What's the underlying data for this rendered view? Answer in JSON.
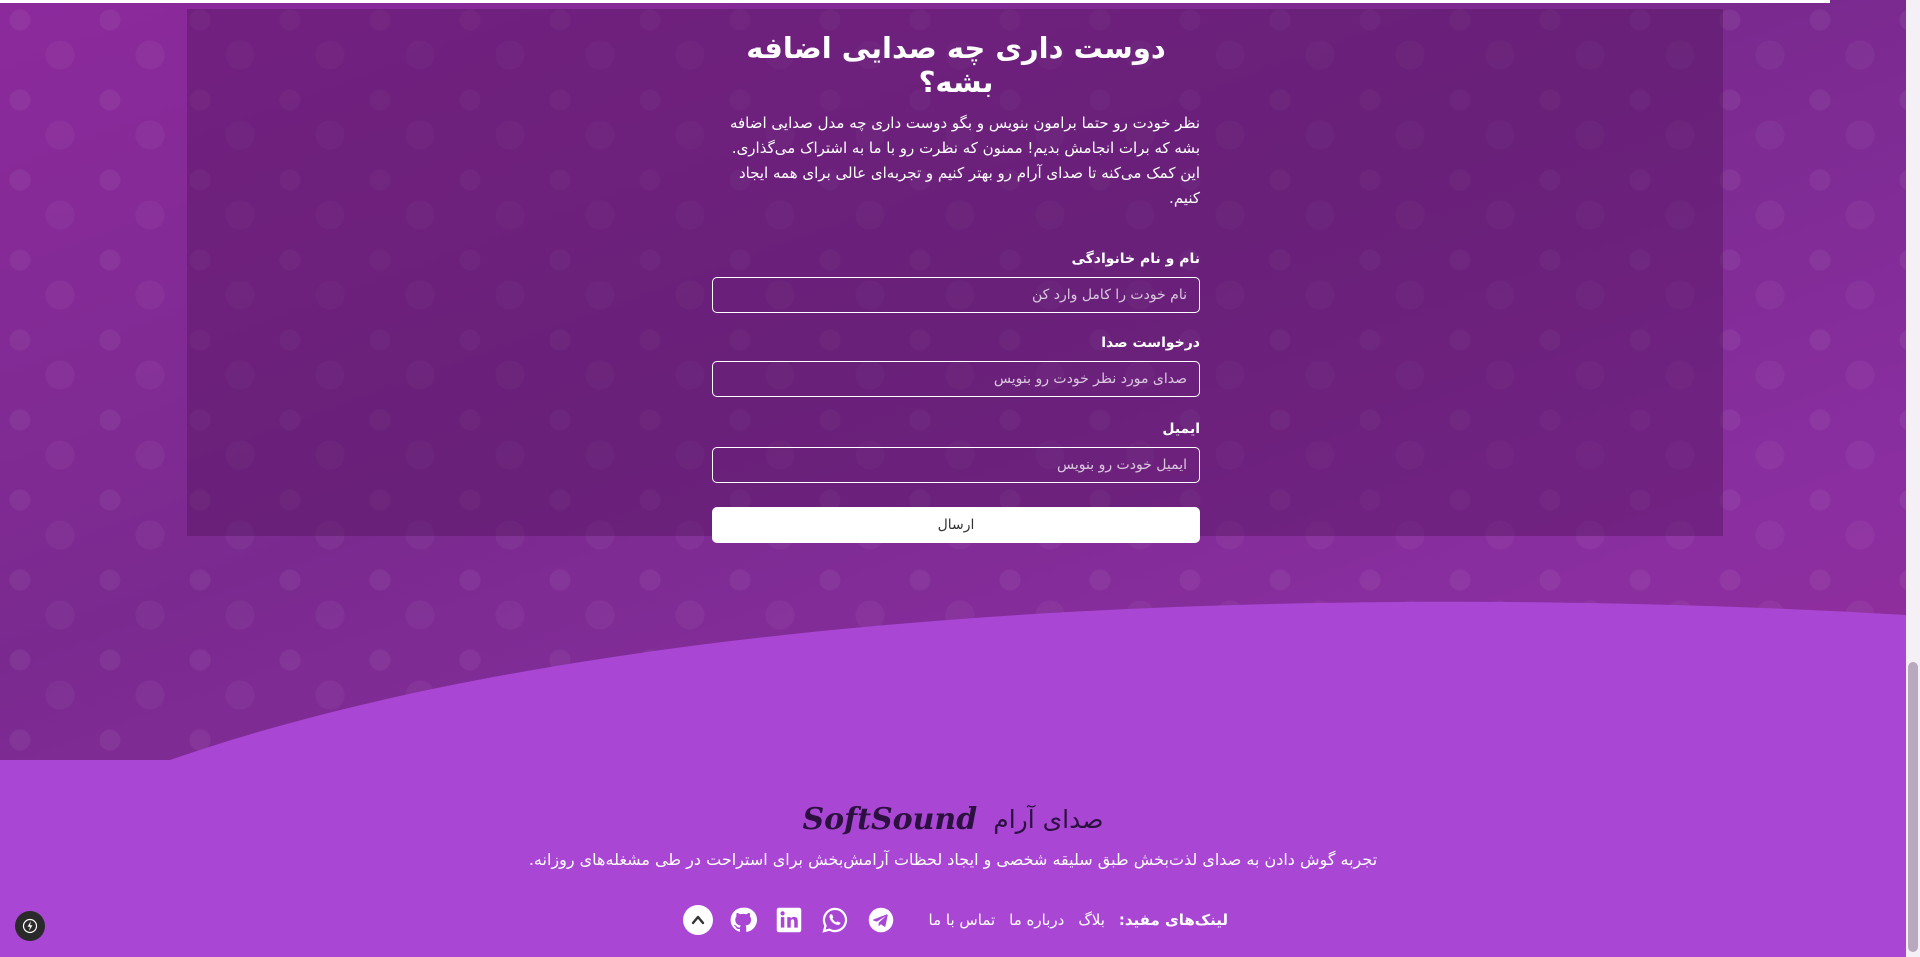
{
  "form": {
    "title": "دوست داری چه صدایی اضافه بشه؟",
    "description": "نظر خودت رو حتما برامون بنویس و بگو دوست داری چه مدل صدایی اضافه بشه که برات انجامش بدیم! ممنون که نظرت رو با ما به اشتراک می‌گذاری. این کمک می‌کنه تا صدای آرام رو بهتر کنیم و تجربه‌ای عالی برای همه ایجاد کنیم.",
    "fields": [
      {
        "label": "نام و نام خانوادگی",
        "placeholder": "نام خودت را کامل وارد کن",
        "value": ""
      },
      {
        "label": "درخواست صدا",
        "placeholder": "صدای مورد نظر خودت رو بنویس",
        "value": ""
      },
      {
        "label": "ایمیل",
        "placeholder": "ایمیل خودت رو بنویس",
        "value": ""
      }
    ],
    "submit_label": "ارسال"
  },
  "footer": {
    "brand_fa": "صدای آرام",
    "brand_en": "SoftSound",
    "tagline": "تجربه گوش دادن به صدای لذت‌بخش طبق سلیقه شخصی و ایجاد لحظات آرامش‌بخش برای استراحت در طی مشغله‌های روزانه.",
    "links_title": "لینک‌های مفید:",
    "links": [
      "بلاگ",
      "درباره ما",
      "تماس با ما"
    ],
    "socials": [
      "telegram-icon",
      "whatsapp-icon",
      "linkedin-icon",
      "github-icon"
    ]
  },
  "colors": {
    "background": "#8a2c98",
    "footer": "#a946d4",
    "form_card": "#5a1a6a",
    "brand_text": "#2b1040"
  }
}
